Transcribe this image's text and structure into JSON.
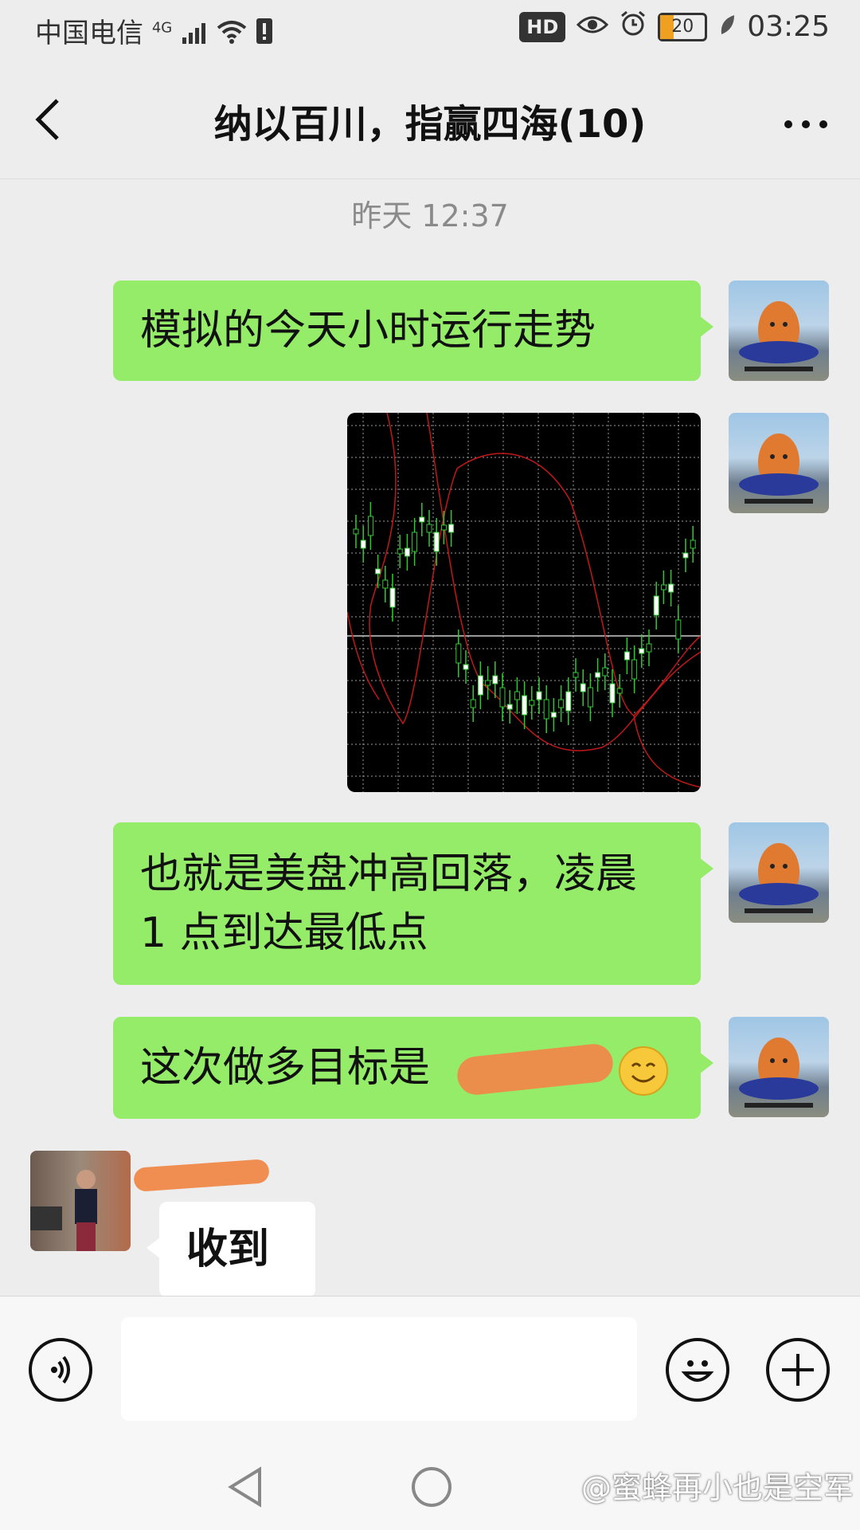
{
  "status_bar": {
    "carrier": "中国电信",
    "network": "4G",
    "hd_label": "HD",
    "battery": "20",
    "time": "03:25"
  },
  "header": {
    "title": "纳以百川，指赢四海(10)"
  },
  "timestamp": "昨天 12:37",
  "messages": [
    {
      "text": "模拟的今天小时运行走势"
    },
    {
      "text": "也就是美盘冲高回落，凌晨 1 点到达最低点"
    },
    {
      "text": "这次做多目标是"
    },
    {
      "text": "收到"
    }
  ],
  "colors": {
    "bubble_out": "#95ec69",
    "bubble_in": "#ffffff",
    "background": "#ededed",
    "candle": "#32c832",
    "envelope": "#c01818"
  },
  "icons": [
    "back-arrow-icon",
    "more-icon",
    "voice-icon",
    "emoji-icon",
    "add-icon",
    "nav-back-icon",
    "nav-home-icon"
  ],
  "watermark": "@蜜蜂再小也是空军"
}
